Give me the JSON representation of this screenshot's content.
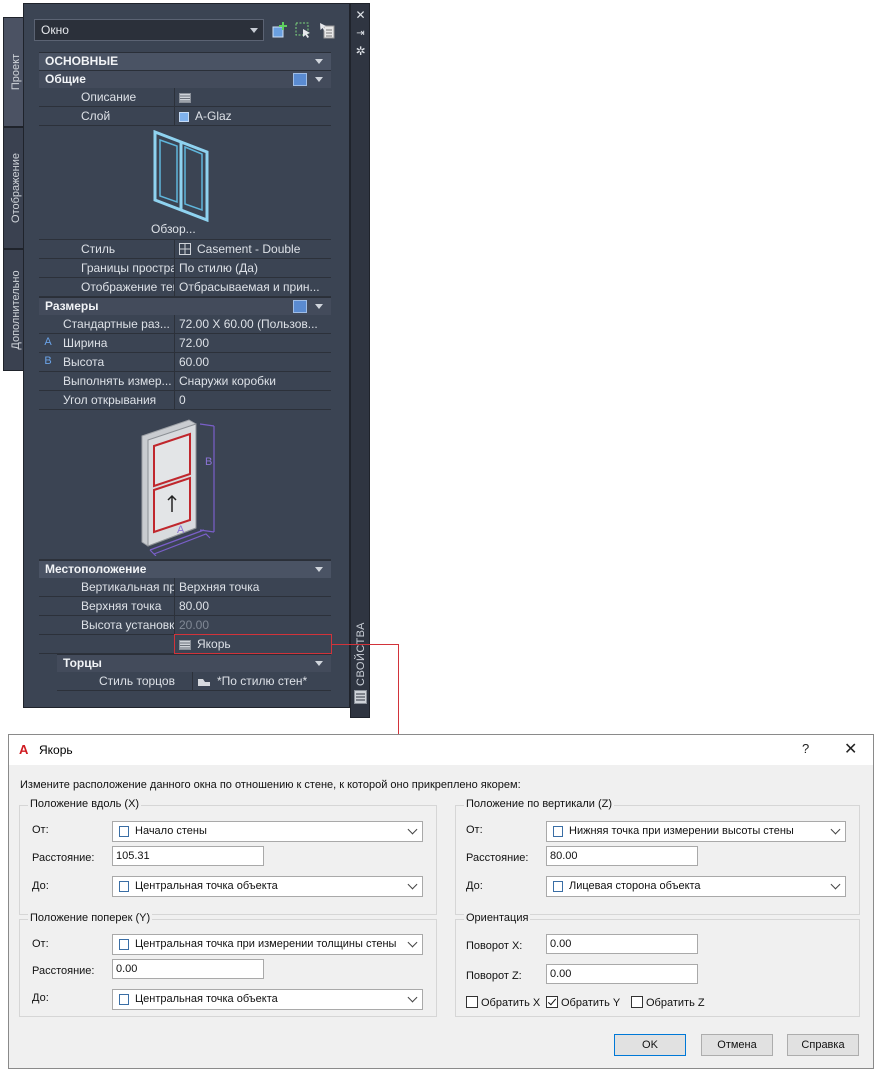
{
  "palette": {
    "side_tabs": [
      "Проект",
      "Отображение",
      "Дополнительно"
    ],
    "object_selector": "Окно",
    "vertical_title": "СВОЙСТВА",
    "categories": {
      "main": "ОСНОВНЫЕ",
      "general": "Общие",
      "dimensions": "Размеры",
      "location": "Местоположение",
      "end_caps": "Торцы"
    },
    "general_rows": [
      {
        "label": "Описание",
        "value": ""
      },
      {
        "label": "Слой",
        "value": "A-Glaz"
      }
    ],
    "preview_caption": "Обзор...",
    "style_rows": [
      {
        "label": "Стиль",
        "value": "Casement - Double"
      },
      {
        "label": "Границы простра...",
        "value": "По стилю (Да)"
      },
      {
        "label": "Отображение тени",
        "value": "Отбрасываемая и прин..."
      }
    ],
    "dimension_rows": [
      {
        "marker": "",
        "label": "Стандартные раз...",
        "value": "72.00 X 60.00 (Пользов..."
      },
      {
        "marker": "A",
        "label": "Ширина",
        "value": "72.00"
      },
      {
        "marker": "B",
        "label": "Высота",
        "value": "60.00"
      },
      {
        "marker": "",
        "label": "Выполнять измер...",
        "value": "Снаружи коробки"
      },
      {
        "marker": "",
        "label": "Угол открывания",
        "value": "0"
      }
    ],
    "diagram_labels": {
      "a": "A",
      "b": "B"
    },
    "location_rows": [
      {
        "label": "Вертикальная пр...",
        "value": "Верхняя точка"
      },
      {
        "label": "Верхняя точка",
        "value": "80.00"
      },
      {
        "label": "Высота установки...",
        "value": "20.00"
      }
    ],
    "anchor_value": "Якорь",
    "end_cap_rows": [
      {
        "label": "Стиль торцов",
        "value": "*По стилю стен*"
      }
    ]
  },
  "dialog": {
    "title": "Якорь",
    "help": "?",
    "close": "✕",
    "instruction": "Измените расположение данного окна по отношению к стене, к которой оно прикреплено якорем:",
    "along": {
      "title": "Положение вдоль (X)",
      "from_label": "От:",
      "from_value": "Начало стены",
      "distance_label": "Расстояние:",
      "distance_value": "105.31",
      "to_label": "До:",
      "to_value": "Центральная точка объекта"
    },
    "across": {
      "title": "Положение поперек (Y)",
      "from_label": "От:",
      "from_value": "Центральная точка при измерении толщины стены",
      "distance_label": "Расстояние:",
      "distance_value": "0.00",
      "to_label": "До:",
      "to_value": "Центральная точка объекта"
    },
    "vertical": {
      "title": "Положение по вертикали (Z)",
      "from_label": "От:",
      "from_value": "Нижняя точка при измерении высоты стены",
      "distance_label": "Расстояние:",
      "distance_value": "80.00",
      "to_label": "До:",
      "to_value": "Лицевая сторона объекта"
    },
    "orientation": {
      "title": "Ориентация",
      "rot_x_label": "Поворот X:",
      "rot_x_value": "0.00",
      "rot_z_label": "Поворот Z:",
      "rot_z_value": "0.00",
      "flip_x": "Обратить X",
      "flip_y": "Обратить Y",
      "flip_z": "Обратить Z",
      "flip_x_checked": false,
      "flip_y_checked": true,
      "flip_z_checked": false
    },
    "buttons": {
      "ok": "OK",
      "cancel": "Отмена",
      "help": "Справка"
    }
  },
  "colors": {
    "palette_bg": "#3b4453",
    "category_bg": "#4a5364",
    "highlight_red": "#d2333a",
    "dialog_bg": "#f0f0f0",
    "accent_blue": "#0078d7"
  }
}
